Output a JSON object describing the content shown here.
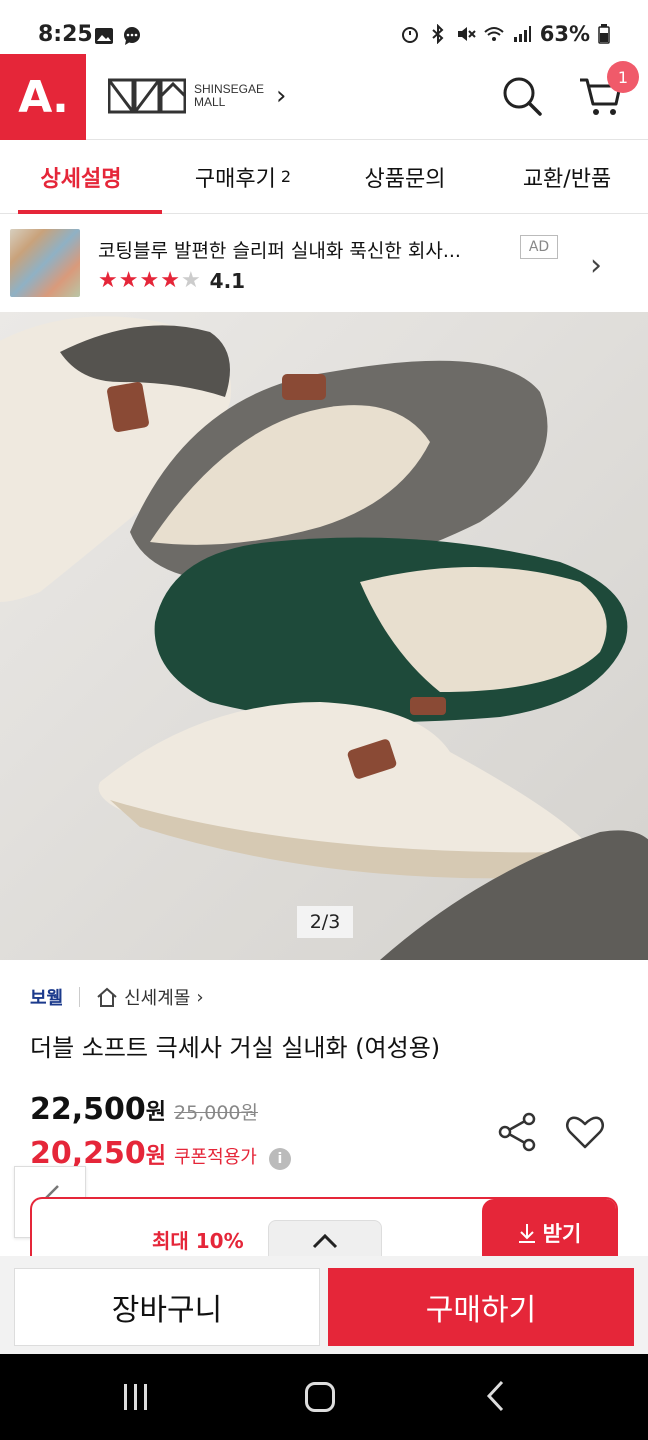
{
  "status_bar": {
    "time": "8:25",
    "battery": "63%"
  },
  "app_bar": {
    "logo": "A.",
    "mall_name_line1": "SHINSEGAE",
    "mall_name_line2": "MALL",
    "cart_count": "1"
  },
  "tabs": [
    {
      "label": "상세설명",
      "count": ""
    },
    {
      "label": "구매후기",
      "count": "2"
    },
    {
      "label": "상품문의",
      "count": ""
    },
    {
      "label": "교환/반품",
      "count": ""
    }
  ],
  "ad": {
    "text": "코팅블루 발편한 슬리퍼 실내화 푹신한 회사...",
    "badge": "AD",
    "rating": "4.1",
    "stars_filled": 4
  },
  "hero": {
    "counter": "2/3"
  },
  "product": {
    "brand": "보웰",
    "store": "신세계몰",
    "title": "더블 소프트 극세사 거실 실내화 (여성용)",
    "price": "22,500",
    "price_unit": "원",
    "old_price": "25,000원",
    "coupon_price": "20,250",
    "coupon_unit": "원",
    "coupon_label": "쿠폰적용가"
  },
  "coupon_bar": {
    "max_text": "최대 10%",
    "receive_label": "받기"
  },
  "bottom_bar": {
    "cart_label": "장바구니",
    "buy_label": "구매하기"
  },
  "colors": {
    "brand_red": "#e52639",
    "brand_blue": "#1b3a8c"
  }
}
